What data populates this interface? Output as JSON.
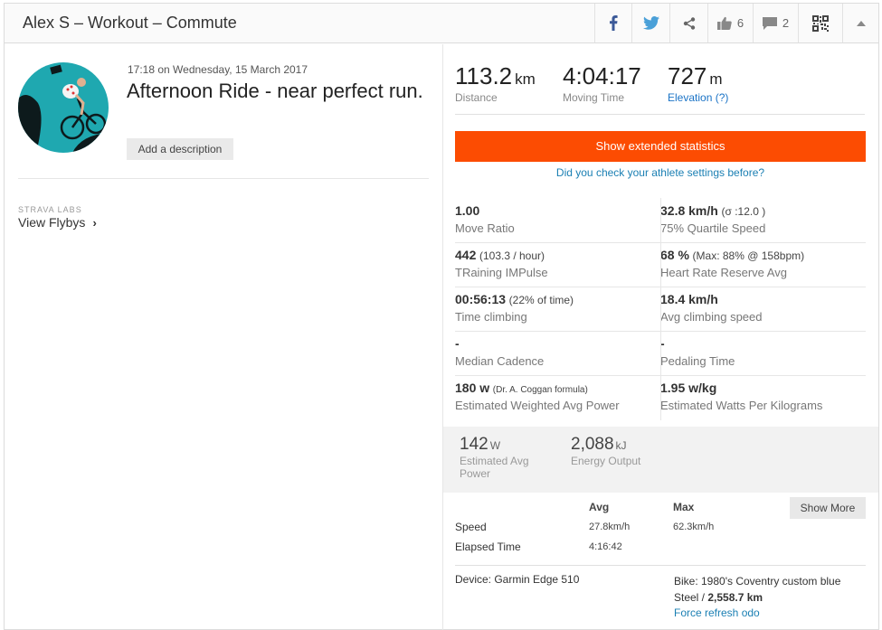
{
  "header": {
    "title": "Alex S – Workout – Commute",
    "kudos_count": "6",
    "comments_count": "2"
  },
  "activity": {
    "timestamp": "17:18 on Wednesday, 15 March 2017",
    "title": "Afternoon Ride - near perfect run.",
    "add_description": "Add a description"
  },
  "labs": {
    "label": "STRAVA LABS",
    "flybys": "View Flybys"
  },
  "summary": [
    {
      "value": "113.2",
      "unit": "km",
      "label": "Distance"
    },
    {
      "value": "4:04:17",
      "unit": "",
      "label": "Moving Time"
    },
    {
      "value": "727",
      "unit": "m",
      "label": "Elevation (?)"
    }
  ],
  "extended": {
    "button": "Show extended statistics",
    "check_link": "Did you check your athlete settings before?"
  },
  "stats": {
    "move_ratio": {
      "value": "1.00",
      "extra": "",
      "label": "Move Ratio"
    },
    "quartile_speed": {
      "value": "32.8 km/h",
      "extra": "(σ :12.0 )",
      "label": "75% Quartile Speed"
    },
    "trimp": {
      "value": "442",
      "extra": "(103.3 / hour)",
      "label": "TRaining IMPulse"
    },
    "hrr": {
      "value": "68 %",
      "extra": "(Max: 88% @ 158bpm)",
      "label": "Heart Rate Reserve Avg"
    },
    "time_climbing": {
      "value": "00:56:13",
      "extra": "(22% of time)",
      "label": "Time climbing"
    },
    "climbing_speed": {
      "value": "18.4 km/h",
      "extra": "",
      "label": "Avg climbing speed"
    },
    "median_cadence": {
      "value": "-",
      "extra": "",
      "label": "Median Cadence"
    },
    "pedaling_time": {
      "value": "-",
      "extra": "",
      "label": "Pedaling Time"
    },
    "weighted_power": {
      "value": "180 w",
      "extra": "(Dr. A. Coggan formula)",
      "label": "Estimated Weighted Avg Power"
    },
    "watts_per_kg": {
      "value": "1.95 w/kg",
      "extra": "",
      "label": "Estimated Watts Per Kilograms"
    }
  },
  "power": {
    "avg_power": {
      "value": "142",
      "unit": "W",
      "label": "Estimated Avg Power"
    },
    "energy": {
      "value": "2,088",
      "unit": "kJ",
      "label": "Energy Output"
    }
  },
  "table": {
    "col_avg": "Avg",
    "col_max": "Max",
    "show_more": "Show More",
    "rows": [
      {
        "label": "Speed",
        "avg": "27.8km/h",
        "max": "62.3km/h"
      },
      {
        "label": "Elapsed Time",
        "avg": "4:16:42",
        "max": ""
      }
    ]
  },
  "device": {
    "text": "Device: Garmin Edge 510",
    "bike_name": "Bike: 1980's Coventry custom blue Steel /",
    "bike_distance": "2,558.7 km",
    "refresh": "Force refresh odo"
  },
  "colors": {
    "accent": "#fc4c02",
    "link": "#1a7fb3",
    "facebook": "#3b5998",
    "twitter": "#4aa0d8"
  }
}
